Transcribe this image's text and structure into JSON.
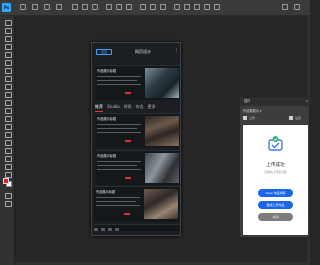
{
  "app": {
    "logo": "Ps"
  },
  "doc": {
    "back_label": "返回",
    "title": "网页设计",
    "tabs": [
      "推荐",
      "Studio",
      "时尚",
      "杂志",
      "更多"
    ],
    "cards": [
      {
        "title": "作品展示标题"
      },
      {
        "title": "作品展示标题"
      },
      {
        "title": "作品展示标题"
      },
      {
        "title": "作品展示标题",
        "number": "50"
      },
      {
        "title": "作品展示标题"
      }
    ]
  },
  "panel": {
    "title": "插件",
    "select_value": "作品集展示",
    "tab_left": "上传",
    "tab_right": "设置",
    "success_title": "上传成功",
    "success_sub": "已成功上传至云端",
    "btn_primary": "View 作品详情",
    "btn_secondary": "继续上传作品",
    "btn_close": "关闭"
  },
  "colors": {
    "accent": "#1a66e8",
    "fg_swatch": "#e01f2c",
    "bg_swatch": "#ffffff"
  }
}
